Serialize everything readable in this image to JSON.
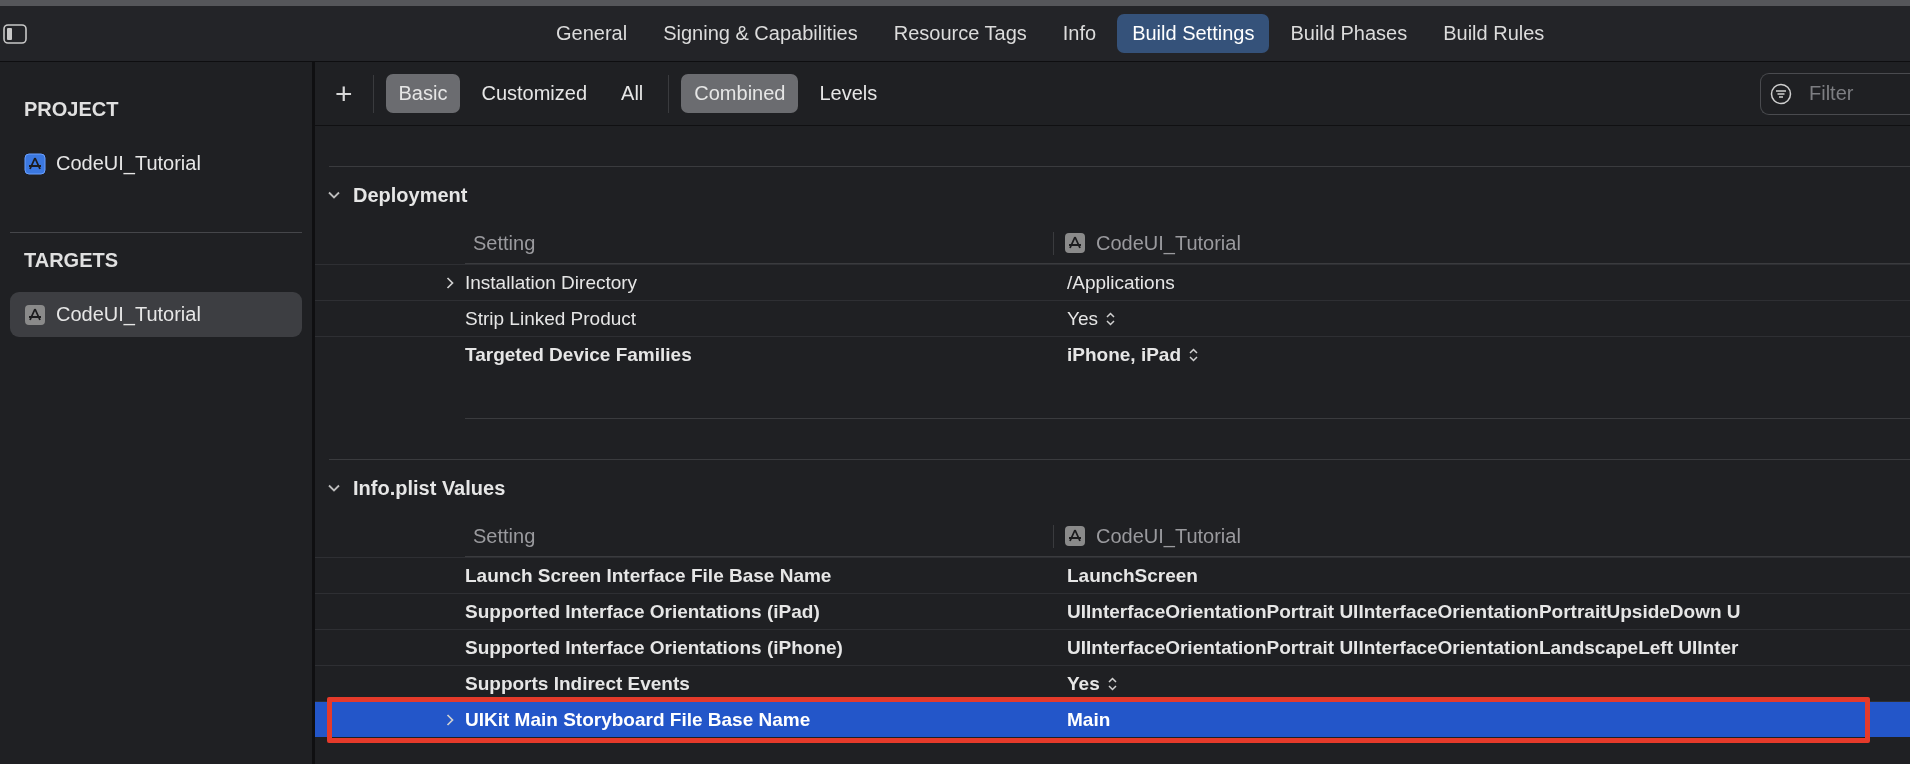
{
  "tabs": [
    {
      "label": "General",
      "selected": false
    },
    {
      "label": "Signing & Capabilities",
      "selected": false
    },
    {
      "label": "Resource Tags",
      "selected": false
    },
    {
      "label": "Info",
      "selected": false
    },
    {
      "label": "Build Settings",
      "selected": true
    },
    {
      "label": "Build Phases",
      "selected": false
    },
    {
      "label": "Build Rules",
      "selected": false
    }
  ],
  "sidebar": {
    "sections": [
      {
        "title": "PROJECT",
        "items": [
          {
            "label": "CodeUI_Tutorial",
            "kind": "project",
            "selected": false
          }
        ]
      },
      {
        "title": "TARGETS",
        "items": [
          {
            "label": "CodeUI_Tutorial",
            "kind": "target",
            "selected": true
          }
        ]
      }
    ]
  },
  "toolbar": {
    "add": "+",
    "scope": [
      {
        "label": "Basic",
        "selected": true
      },
      {
        "label": "Customized",
        "selected": false
      },
      {
        "label": "All",
        "selected": false
      }
    ],
    "view": [
      {
        "label": "Combined",
        "selected": true
      },
      {
        "label": "Levels",
        "selected": false
      }
    ],
    "filter": {
      "placeholder": "Filter"
    }
  },
  "sections": [
    {
      "title": "Deployment",
      "expanded": true,
      "header": {
        "setting": "Setting",
        "target": "CodeUI_Tutorial"
      },
      "rows": [
        {
          "name": "Installation Directory",
          "value": "/Applications",
          "expandable": true,
          "modified": false,
          "popup": false,
          "selected": false,
          "outlined": false
        },
        {
          "name": "Strip Linked Product",
          "value": "Yes",
          "expandable": false,
          "modified": false,
          "popup": true,
          "selected": false,
          "outlined": false
        },
        {
          "name": "Targeted Device Families",
          "value": "iPhone, iPad",
          "expandable": false,
          "modified": true,
          "popup": true,
          "selected": false,
          "outlined": false
        }
      ]
    },
    {
      "title": "Info.plist Values",
      "expanded": true,
      "header": {
        "setting": "Setting",
        "target": "CodeUI_Tutorial"
      },
      "rows": [
        {
          "name": "Launch Screen Interface File Base Name",
          "value": "LaunchScreen",
          "expandable": false,
          "modified": true,
          "popup": false,
          "selected": false,
          "outlined": false
        },
        {
          "name": "Supported Interface Orientations (iPad)",
          "value": "UIInterfaceOrientationPortrait UIInterfaceOrientationPortraitUpsideDown U",
          "expandable": false,
          "modified": true,
          "popup": false,
          "selected": false,
          "outlined": false
        },
        {
          "name": "Supported Interface Orientations (iPhone)",
          "value": "UIInterfaceOrientationPortrait UIInterfaceOrientationLandscapeLeft UIInter",
          "expandable": false,
          "modified": true,
          "popup": false,
          "selected": false,
          "outlined": false
        },
        {
          "name": "Supports Indirect Events",
          "value": "Yes",
          "expandable": false,
          "modified": true,
          "popup": true,
          "selected": false,
          "outlined": false
        },
        {
          "name": "UIKit Main Storyboard File Base Name",
          "value": "Main",
          "expandable": true,
          "modified": true,
          "popup": false,
          "selected": true,
          "outlined": true
        }
      ]
    }
  ]
}
